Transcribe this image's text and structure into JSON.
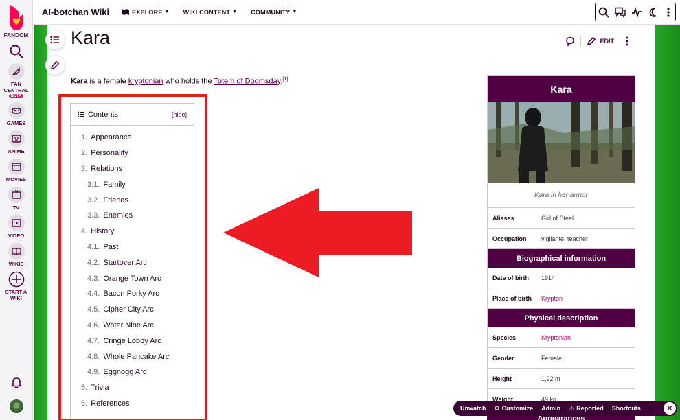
{
  "global_nav": {
    "logo_label": "FANDOM",
    "items": [
      {
        "icon": "rocket-icon",
        "label_lines": [
          "FAN",
          "CENTRAL"
        ],
        "badge": "BETA"
      },
      {
        "icon": "gamepad-icon",
        "label_lines": [
          "GAMES"
        ]
      },
      {
        "icon": "anime-icon",
        "label_lines": [
          "ANIME"
        ]
      },
      {
        "icon": "movie-icon",
        "label_lines": [
          "MOVIES"
        ]
      },
      {
        "icon": "tv-icon",
        "label_lines": [
          "TV"
        ]
      },
      {
        "icon": "video-icon",
        "label_lines": [
          "VIDEO"
        ]
      },
      {
        "icon": "book-icon",
        "label_lines": [
          "WIKIS"
        ]
      },
      {
        "icon": "plus-circle-icon",
        "label_lines": [
          "START A",
          "WIKI"
        ]
      }
    ]
  },
  "topbar": {
    "wiki_title": "AI-botchan Wiki",
    "menu": [
      "EXPLORE",
      "WIKI CONTENT",
      "COMMUNITY"
    ]
  },
  "page": {
    "title": "Kara",
    "edit_label": "EDIT",
    "intro": {
      "bold": "Kara",
      "t1": " is a female ",
      "link1": "kryptonian",
      "t2": " who holds the ",
      "link2": "Totem of Doomsday",
      "t3": ".",
      "ref": "[1]"
    }
  },
  "toc": {
    "title": "Contents",
    "hide_label": "[hide]",
    "items": [
      {
        "num": "1.",
        "label": "Appearance",
        "level": 1
      },
      {
        "num": "2.",
        "label": "Personality",
        "level": 1
      },
      {
        "num": "3.",
        "label": "Relations",
        "level": 1
      },
      {
        "num": "3.1.",
        "label": "Family",
        "level": 2
      },
      {
        "num": "3.2.",
        "label": "Friends",
        "level": 2
      },
      {
        "num": "3.3.",
        "label": "Enemies",
        "level": 2
      },
      {
        "num": "4.",
        "label": "History",
        "level": 1
      },
      {
        "num": "4.1.",
        "label": "Past",
        "level": 2
      },
      {
        "num": "4.2.",
        "label": "Startover Arc",
        "level": 2
      },
      {
        "num": "4.3.",
        "label": "Orange Town Arc",
        "level": 2
      },
      {
        "num": "4.4.",
        "label": "Bacon Porky Arc",
        "level": 2
      },
      {
        "num": "4.5.",
        "label": "Cipher City Arc",
        "level": 2
      },
      {
        "num": "4.6.",
        "label": "Water Nine Arc",
        "level": 2
      },
      {
        "num": "4.7.",
        "label": "Cringe Lobby Arc",
        "level": 2
      },
      {
        "num": "4.8.",
        "label": "Whole Pancake Arc",
        "level": 2
      },
      {
        "num": "4.9.",
        "label": "Eggnogg Arc",
        "level": 2
      },
      {
        "num": "5.",
        "label": "Trivia",
        "level": 1
      },
      {
        "num": "6.",
        "label": "References",
        "level": 1
      }
    ]
  },
  "infobox": {
    "title": "Kara",
    "caption": "Kara in her armor",
    "rows_top": [
      {
        "k": "Aliases",
        "v": "Girl of Steel",
        "link": false
      },
      {
        "k": "Occupation",
        "v": "vigilante, teacher",
        "link": false
      }
    ],
    "section_bio": "Biographical information",
    "rows_bio": [
      {
        "k": "Date of birth",
        "v": "1914",
        "link": false
      },
      {
        "k": "Place of birth",
        "v": "Krypton",
        "link": true
      }
    ],
    "section_phys": "Physical description",
    "rows_phys": [
      {
        "k": "Species",
        "v": "Kryptonian",
        "link": true
      },
      {
        "k": "Gender",
        "v": "Female",
        "link": false
      },
      {
        "k": "Height",
        "v": "1,92 m",
        "link": false
      },
      {
        "k": "Weight",
        "v": "49 kg",
        "link": false
      }
    ],
    "section_next": "Appearances"
  },
  "adminbar": {
    "items": [
      "Unwatch",
      "Customize",
      "Admin",
      "Reported",
      "Shortcuts"
    ]
  },
  "colors": {
    "brand": "#520044",
    "highlight_red": "#e81b23",
    "link": "#b5006e"
  }
}
